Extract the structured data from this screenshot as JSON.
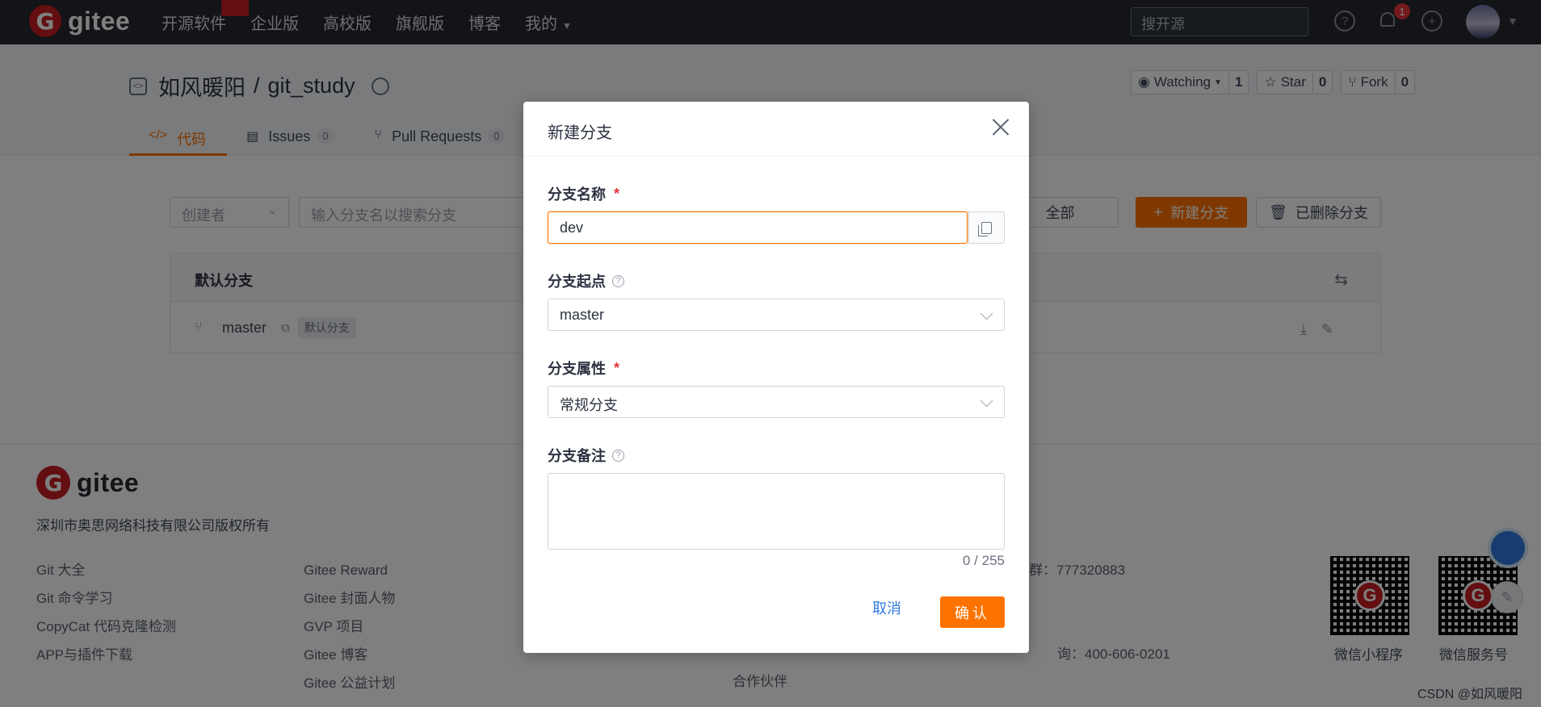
{
  "nav": {
    "brand": "gitee",
    "brand_mark": "G",
    "links": [
      "开源软件",
      "企业版",
      "高校版",
      "旗舰版",
      "博客"
    ],
    "my_label": "我的",
    "search_placeholder": "搜开源",
    "notification_count": "1"
  },
  "repo": {
    "owner": "如风暖阳",
    "separator": "/",
    "name": "git_study",
    "watch_label": "Watching",
    "watch_count": "1",
    "star_label": "Star",
    "star_count": "0",
    "fork_label": "Fork",
    "fork_count": "0",
    "tabs": [
      {
        "icon": "</>",
        "label": "代码"
      },
      {
        "label": "Issues",
        "count": "0"
      },
      {
        "label": "Pull Requests",
        "count": "0"
      }
    ]
  },
  "branches": {
    "creator_placeholder": "创建者",
    "search_placeholder": "输入分支名以搜索分支",
    "all_label": "全部",
    "new_label": "新建分支",
    "deleted_label": "已删除分支",
    "default_heading": "默认分支",
    "default_branch": "master",
    "default_tag": "默认分支"
  },
  "footer": {
    "brand": "gitee",
    "brand_mark": "G",
    "copyright": "深圳市奥思网络科技有限公司版权所有",
    "col1": [
      "Git 大全",
      "Git 命令学习",
      "CopyCat 代码克隆检测",
      "APP与插件下载"
    ],
    "col2": [
      "Gitee Reward",
      "Gitee 封面人物",
      "GVP 项目",
      "Gitee 博客",
      "Gitee 公益计划"
    ],
    "col3_partial": "合作伙伴",
    "contact_group": "群：777320883",
    "contact_phone": "询：400-606-0201",
    "qr1_label": "微信小程序",
    "qr2_label": "微信服务号",
    "watermark": "CSDN @如风暖阳"
  },
  "modal": {
    "title": "新建分支",
    "name_label": "分支名称",
    "name_value": "dev",
    "origin_label": "分支起点",
    "origin_value": "master",
    "attr_label": "分支属性",
    "attr_value": "常规分支",
    "remark_label": "分支备注",
    "remark_counter": "0 / 255",
    "required_mark": "*",
    "help_mark": "?",
    "cancel_label": "取消",
    "confirm_label": "确认"
  },
  "colors": {
    "accent": "#fe7300",
    "brand_red": "#c71d23",
    "nav_bg": "#24292f",
    "link_blue": "#2f7be0"
  }
}
